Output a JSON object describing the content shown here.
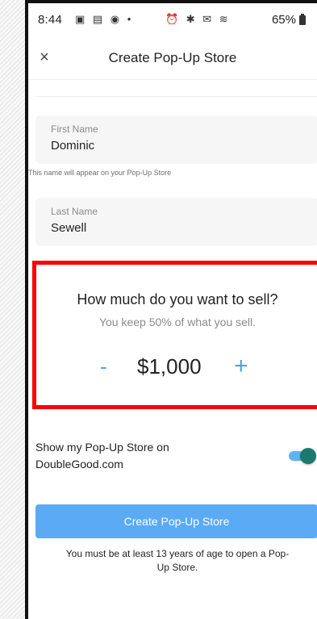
{
  "status_bar": {
    "time": "8:44",
    "left_icons": "▣ ▤ ◉ •",
    "right_icons": "⏰ ✱ ✉ ≋",
    "battery": "65%"
  },
  "header": {
    "close_icon": "×",
    "title": "Create Pop-Up Store"
  },
  "form": {
    "first_name": {
      "label": "First Name",
      "value": "Dominic",
      "helper": "This name will appear on your Pop-Up Store"
    },
    "last_name": {
      "label": "Last Name",
      "value": "Sewell"
    },
    "sell": {
      "question": "How much do you want to sell?",
      "subtitle": "You keep 50% of what you sell.",
      "minus": "-",
      "amount": "$1,000",
      "plus": "+"
    },
    "toggle": {
      "label": "Show my Pop-Up Store on DoubleGood.com",
      "on": true
    },
    "submit_label": "Create Pop-Up Store",
    "age_note": "You must be at least 13 years of age to open a Pop-Up Store."
  },
  "colors": {
    "accent": "#5aaaf5",
    "highlight_border": "#ff0000",
    "toggle_knob": "#1a7a6c"
  }
}
